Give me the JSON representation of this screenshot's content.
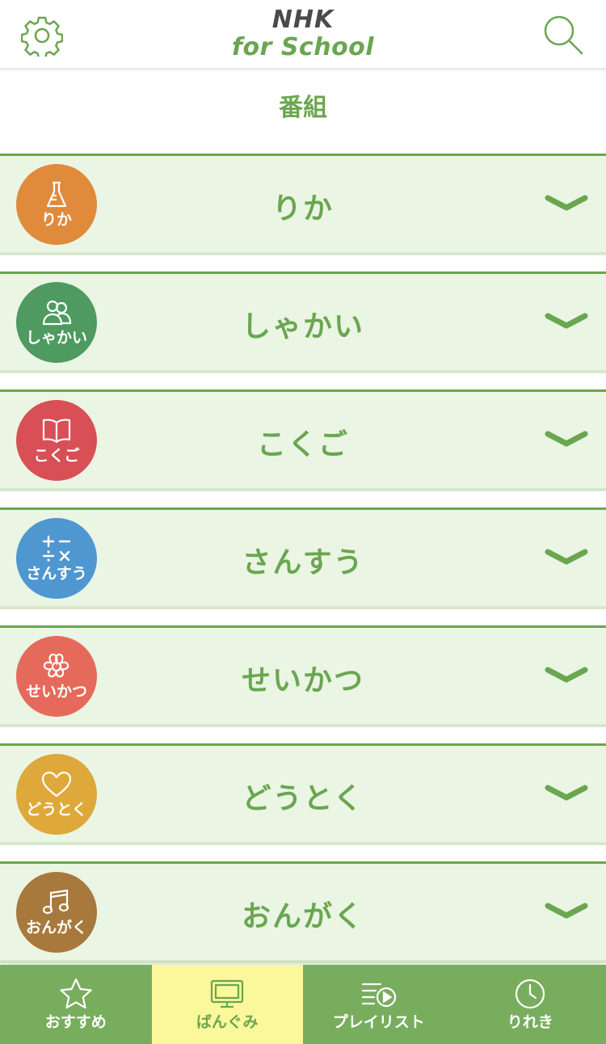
{
  "header": {
    "logo_top": "NHK",
    "logo_bottom": "for School",
    "settings_icon": "gear-icon",
    "search_icon": "search-icon"
  },
  "page_title": "番組",
  "subjects": [
    {
      "badge": "りか",
      "name": "りか",
      "color": "#e08a3c",
      "icon": "flask-icon"
    },
    {
      "badge": "しゃかい",
      "name": "しゃかい",
      "color": "#4e9a60",
      "icon": "people-icon"
    },
    {
      "badge": "こくご",
      "name": "こくご",
      "color": "#d84f56",
      "icon": "book-icon"
    },
    {
      "badge": "さんすう",
      "name": "さんすう",
      "color": "#4f97d0",
      "icon": "math-icon"
    },
    {
      "badge": "せいかつ",
      "name": "せいかつ",
      "color": "#e66a5c",
      "icon": "flower-icon"
    },
    {
      "badge": "どうとく",
      "name": "どうとく",
      "color": "#dea83a",
      "icon": "heart-icon"
    },
    {
      "badge": "おんがく",
      "name": "おんがく",
      "color": "#a8793c",
      "icon": "music-note-icon"
    }
  ],
  "bottom_nav": [
    {
      "label": "おすすめ",
      "icon": "star-icon",
      "active": false
    },
    {
      "label": "ばんぐみ",
      "icon": "tv-icon",
      "active": true
    },
    {
      "label": "プレイリスト",
      "icon": "playlist-icon",
      "active": false
    },
    {
      "label": "りれき",
      "icon": "clock-icon",
      "active": false
    }
  ],
  "colors": {
    "accent": "#6aa650",
    "row_bg": "#eaf5e4",
    "nav_bg": "#78ad5e",
    "nav_active_bg": "#fbf79b"
  }
}
